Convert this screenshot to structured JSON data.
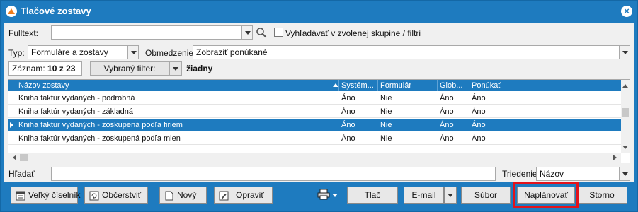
{
  "window": {
    "title": "Tlačové zostavy"
  },
  "filters": {
    "fulltext_label": "Fulltext:",
    "fulltext_value": "",
    "search_in_group_label": "Vyhľadávať v zvolenej skupine / filtri",
    "typ_label": "Typ:",
    "typ_value": "Formuláre a zostavy",
    "obmedzenie_label": "Obmedzenie:",
    "obmedzenie_value": "Zobraziť ponúkané"
  },
  "record_bar": {
    "zaznam_label": "Záznam:",
    "current": "10",
    "of": "z",
    "total": "23",
    "filter_button": "Vybraný filter:",
    "filter_value": "žiadny"
  },
  "grid": {
    "columns": [
      "Názov zostavy",
      "Systém...",
      "Formulár",
      "Glob...",
      "Ponúkať"
    ],
    "rows": [
      [
        "Kniha faktúr vydaných - podrobná",
        "Áno",
        "Nie",
        "Áno",
        "Áno"
      ],
      [
        "Kniha faktúr vydaných - základná",
        "Áno",
        "Nie",
        "Áno",
        "Áno"
      ],
      [
        "Kniha faktúr vydaných - zoskupená podľa firiem",
        "Áno",
        "Nie",
        "Áno",
        "Áno"
      ],
      [
        "Kniha faktúr vydaných - zoskupená podľa mien",
        "Áno",
        "Nie",
        "Áno",
        "Áno"
      ]
    ],
    "selected_row": 2
  },
  "search": {
    "hladat_label": "Hľadať",
    "hladat_value": "",
    "triedenie_label": "Triedenie:",
    "triedenie_value": "Názov"
  },
  "toolbar": {
    "velky_ciselnik": "Veľký číselník",
    "obcerstvit": "Občerstviť",
    "novy": "Nový",
    "opravit": "Opraviť",
    "tlac": "Tlač",
    "email": "E-mail",
    "subor": "Súbor",
    "naplanovat": "Naplánovať",
    "storno": "Storno"
  },
  "colors": {
    "accent": "#1e7bbf",
    "highlight": "#e3131b"
  }
}
